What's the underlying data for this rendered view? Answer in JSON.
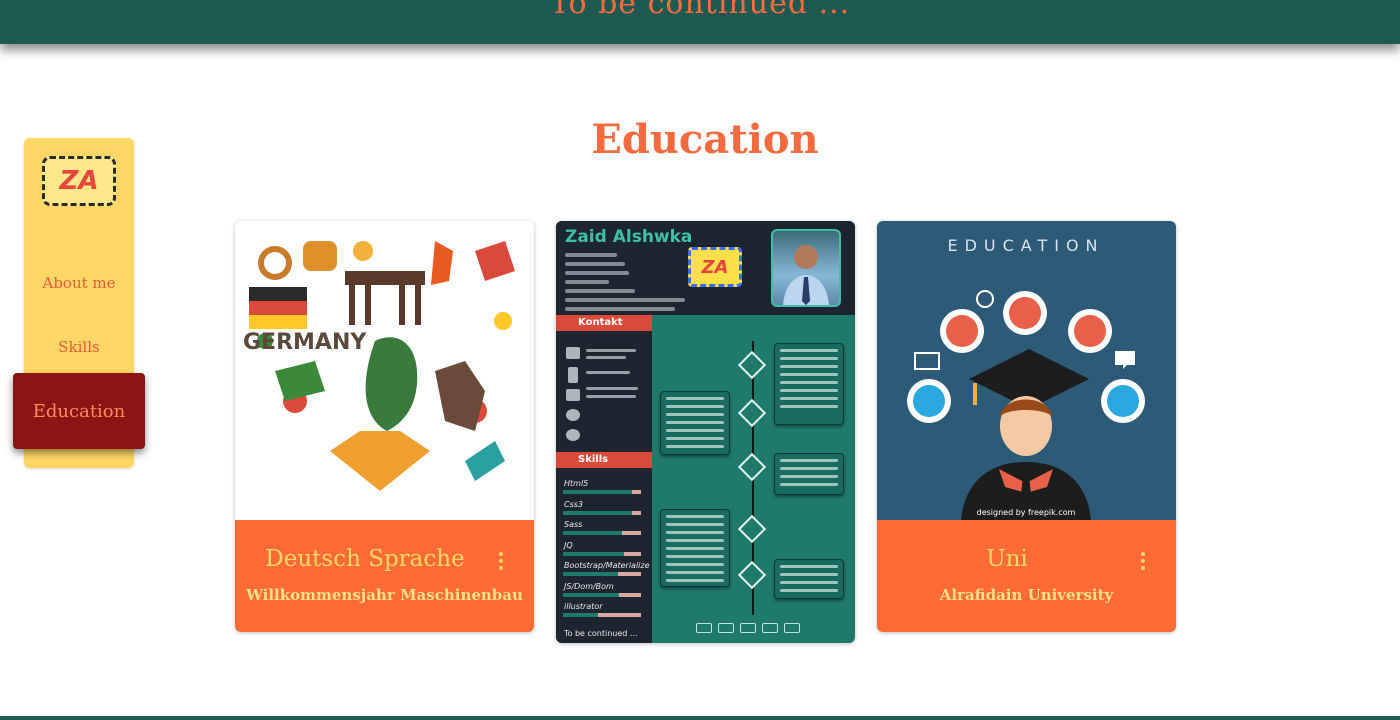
{
  "header": {
    "text": "To be continued ..."
  },
  "sidebar": {
    "logo_text": "ZA",
    "items": [
      {
        "label": "About me"
      },
      {
        "label": "Skills"
      },
      {
        "label": "Education",
        "active": true
      }
    ]
  },
  "main": {
    "title": "Education",
    "cards": [
      {
        "title": "Deutsch Sprache",
        "subtitle": "Willkommensjahr Maschinenbau",
        "image": "germany-heart-illustration",
        "image_text": "GERMANY"
      },
      {
        "image": "cv-preview",
        "cv_name": "Zaid Alshwka",
        "cv_logo": "ZA",
        "cv_contact": "Kontakt",
        "cv_skills": "Skills",
        "cv_skill_list": [
          "Html5",
          "Css3",
          "Sass",
          "JQ",
          "Bootstrap/Materialize",
          "JS/Dom/Bom",
          "illustrator"
        ],
        "cv_skill_levels": [
          0.88,
          0.88,
          0.75,
          0.78,
          0.7,
          0.72,
          0.45
        ],
        "cv_footer": "To be continued ..."
      },
      {
        "title": "Uni",
        "subtitle": "Alrafidain University",
        "image": "education-graduate-illustration",
        "image_text": "EDUCATION",
        "credit": "designed by freepik.com"
      }
    ]
  },
  "colors": {
    "header": "#1f5a52",
    "accent": "#f26a3e",
    "sidebar": "#ffd766",
    "active": "#8b1414",
    "card_footer": "#ff6b35"
  }
}
